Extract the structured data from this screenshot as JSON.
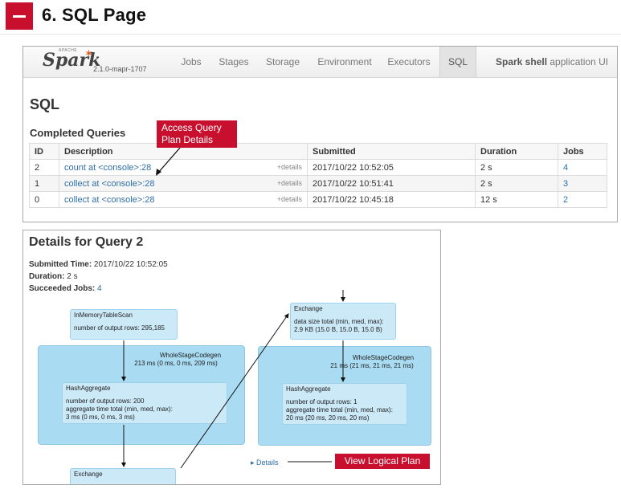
{
  "heading": {
    "title": "6. SQL Page"
  },
  "sparkui": {
    "brand": "Spark",
    "brand_apache": "APACHE",
    "version": "2.1.0-mapr-1707",
    "tabs": [
      "Jobs",
      "Stages",
      "Storage",
      "Environment",
      "Executors",
      "SQL"
    ],
    "active_tab": "SQL",
    "app_name_bold": "Spark shell",
    "app_name_rest": " application UI",
    "page_title": "SQL",
    "section_title": "Completed Queries",
    "columns": [
      "ID",
      "Description",
      "Submitted",
      "Duration",
      "Jobs"
    ],
    "rows": [
      {
        "id": "2",
        "description": "count at <console>:28",
        "details": "+details",
        "submitted": "2017/10/22 10:52:05",
        "duration": "2 s",
        "jobs": "4"
      },
      {
        "id": "1",
        "description": "collect at <console>:28",
        "details": "+details",
        "submitted": "2017/10/22 10:51:41",
        "duration": "2 s",
        "jobs": "3"
      },
      {
        "id": "0",
        "description": "collect at <console>:28",
        "details": "+details",
        "submitted": "2017/10/22 10:45:18",
        "duration": "12 s",
        "jobs": "2"
      }
    ]
  },
  "callouts": {
    "access_plan_line1": "Access Query",
    "access_plan_line2": "Plan Details",
    "view_logical": "View Logical Plan"
  },
  "query_details": {
    "title": "Details for Query 2",
    "submitted_label": "Submitted Time:",
    "submitted_value": " 2017/10/22 10:52:05",
    "duration_label": "Duration:",
    "duration_value": " 2 s",
    "jobs_label": "Succeeded Jobs:",
    "jobs_value": "4",
    "details_link": "Details",
    "plan": {
      "scan_title": "InMemoryTableScan",
      "scan_metric": "number of output rows: 295,185",
      "wsc_left_title": "WholeStageCodegen",
      "wsc_left_metric": "213 ms (0 ms, 0 ms, 209 ms)",
      "hash_left_title": "HashAggregate",
      "hash_left_l1": "number of output rows: 200",
      "hash_left_l2": "aggregate time total (min, med, max):",
      "hash_left_l3": "3 ms (0 ms, 0 ms, 3 ms)",
      "exchange_bottom_title": "Exchange",
      "exchange_top_title": "Exchange",
      "exchange_top_l1": "data size total (min, med, max):",
      "exchange_top_l2": "2.9 KB (15.0 B, 15.0 B, 15.0 B)",
      "wsc_right_title": "WholeStageCodegen",
      "wsc_right_metric": "21 ms (21 ms, 21 ms, 21 ms)",
      "hash_right_title": "HashAggregate",
      "hash_right_l1": "number of output rows: 1",
      "hash_right_l2": "aggregate time total (min, med, max):",
      "hash_right_l3": "20 ms (20 ms, 20 ms, 20 ms)"
    }
  }
}
